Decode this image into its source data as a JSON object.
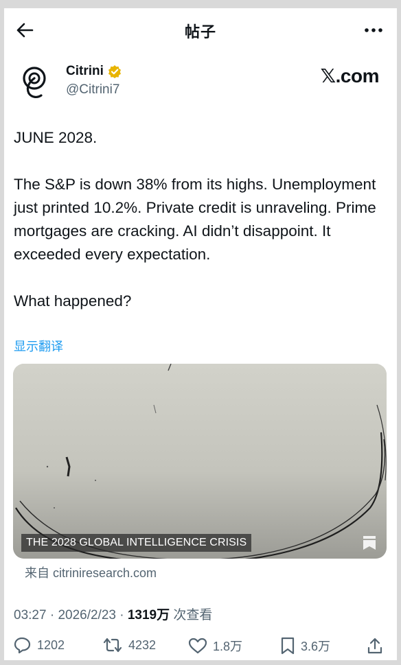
{
  "header": {
    "title": "帖子"
  },
  "author": {
    "name": "Citrini",
    "handle": "@Citrini7",
    "verified": true,
    "verified_color": "#e8b400",
    "site_label": "𝕏.com"
  },
  "post": {
    "paragraphs": [
      "JUNE 2028.",
      "The S&P is down 38% from its highs. Unemployment just printed 10.2%. Private credit is unraveling. Prime mortgages are cracking. AI didn’t disappoint. It exceeded every expectation.",
      "What happened?"
    ],
    "translate_label": "显示翻译"
  },
  "media": {
    "caption": "THE 2028 GLOBAL INTELLIGENCE CRISIS",
    "source_label": "来自 citriniresearch.com"
  },
  "meta": {
    "time": "03:27",
    "date": "2026/2/23",
    "views": "1319万",
    "views_suffix": "次查看"
  },
  "actions": {
    "replies": "1202",
    "reposts": "4232",
    "likes": "1.8万",
    "bookmarks": "3.6万"
  },
  "colors": {
    "accent": "#1d9bf0",
    "text_primary": "#0f1419",
    "text_secondary": "#536471"
  }
}
